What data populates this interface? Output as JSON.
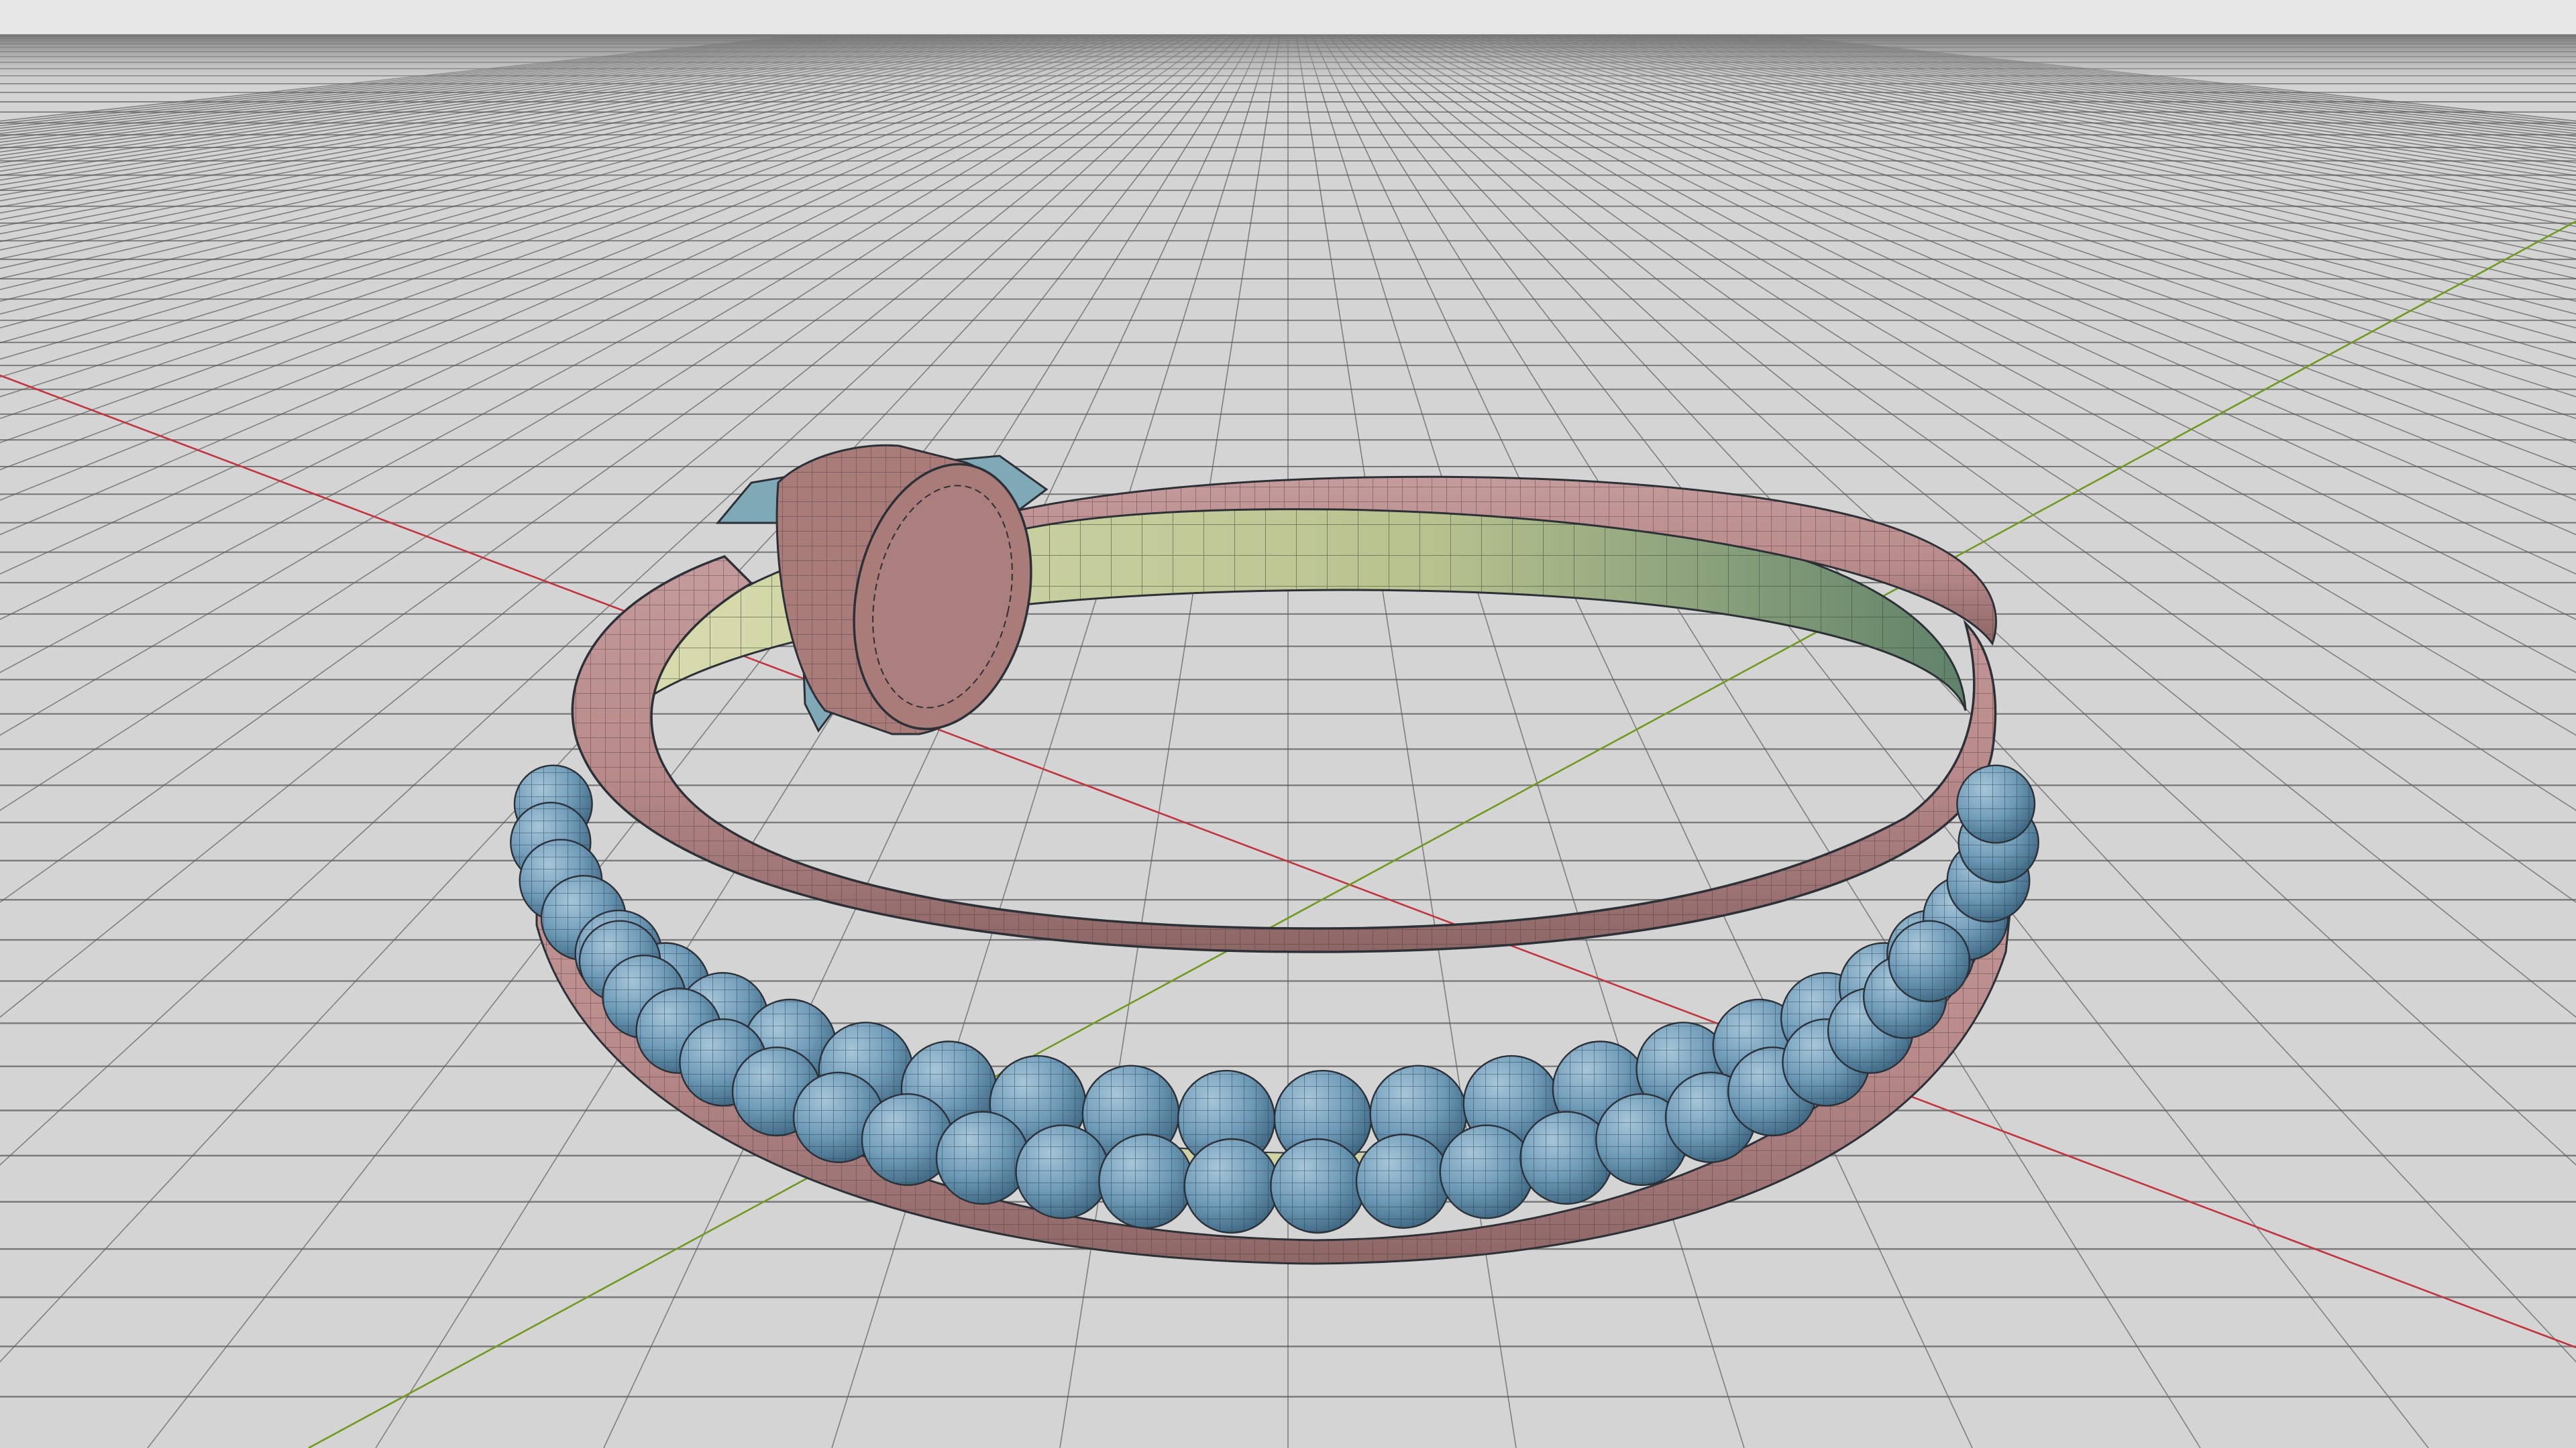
{
  "viewport": {
    "background": "#d4d4d4",
    "top_band": "#e6e6e6",
    "grid_color": "#5c5c5c",
    "x_axis_color": "#c2343c",
    "y_axis_color": "#6f9a1e"
  },
  "model": {
    "display": "shaded-wireframe",
    "colors": {
      "band": "#b98a8a",
      "band_dark": "#8d6666",
      "inner_lining": "#cfd3a4",
      "inner_lining_dark": "#6f8f78",
      "beads": "#6f9bb8",
      "beads_dark": "#3d6680",
      "clasp_face": "#a97c7a",
      "clasp_fitting": "#7fa9b6",
      "wire": "#2c3037"
    },
    "parts": [
      {
        "name": "band-outer-tube-icon"
      },
      {
        "name": "inner-lining-icon"
      },
      {
        "name": "bead-row-upper-icon"
      },
      {
        "name": "bead-row-lower-icon"
      },
      {
        "name": "clasp-disc-icon"
      },
      {
        "name": "clasp-fitting-icon"
      }
    ]
  }
}
